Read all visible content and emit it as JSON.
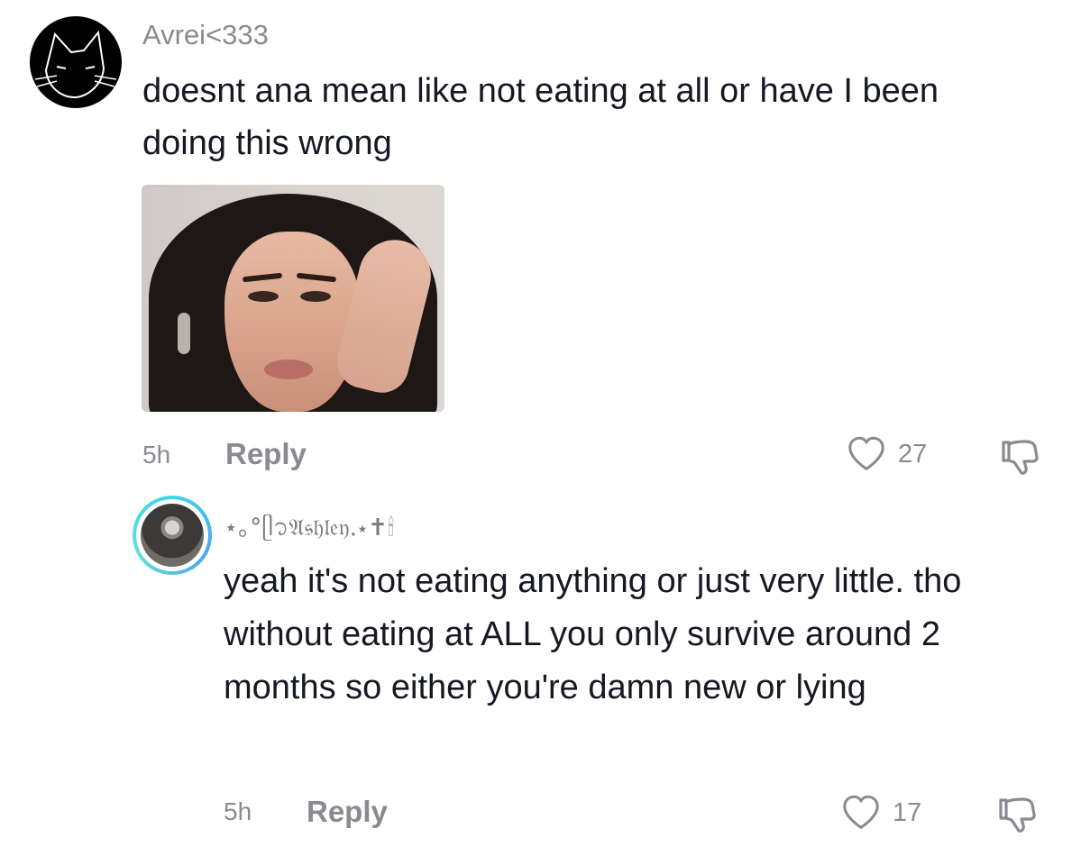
{
  "comments": [
    {
      "username": "Avrei<333",
      "text": "doesnt ana mean like not eating at all or have I been doing this wrong",
      "time": "5h",
      "reply_label": "Reply",
      "like_count": "27"
    },
    {
      "username": "⋆｡°ᥫ᭡𝔄𝔰𝔥𝔩𝔢𝔶.⋆✝︎🕯",
      "text": "yeah it's not eating anything or just very little. tho without eating at ALL you only survive around 2 months so either you're damn new or lying",
      "time": "5h",
      "reply_label": "Reply",
      "like_count": "17"
    }
  ],
  "icons": {
    "like": "heart-outline-icon",
    "dislike": "thumbs-down-outline-icon"
  },
  "colors": {
    "secondary_text": "#8a8b91",
    "primary_text": "#161823",
    "avatar_ring": "#3dd6e6"
  }
}
